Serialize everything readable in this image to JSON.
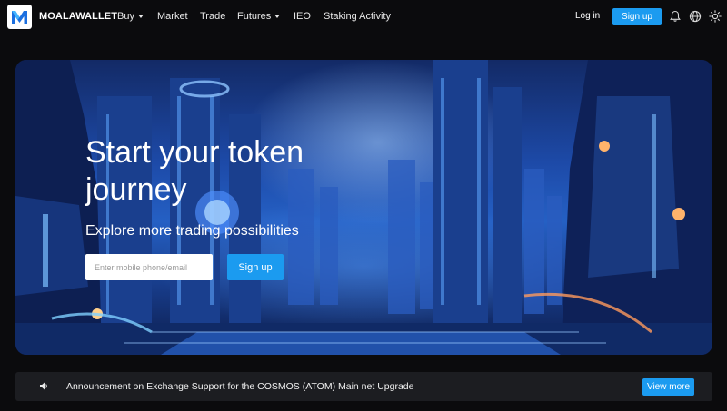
{
  "brand": {
    "logo_letter": "M",
    "name": "MOALAWALLET"
  },
  "nav": {
    "items": [
      {
        "label": "Buy",
        "has_dropdown": true
      },
      {
        "label": "Market",
        "has_dropdown": false
      },
      {
        "label": "Trade",
        "has_dropdown": false
      },
      {
        "label": "Futures",
        "has_dropdown": true
      },
      {
        "label": "IEO",
        "has_dropdown": false
      },
      {
        "label": "Staking Activity",
        "has_dropdown": false
      }
    ],
    "login_label": "Log in",
    "signup_label": "Sign up",
    "icons": [
      "bell-icon",
      "globe-icon",
      "sun-icon"
    ]
  },
  "hero": {
    "title": "Start your token journey",
    "subtitle": "Explore more trading possibilities",
    "input_placeholder": "Enter mobile phone/email",
    "signup_label": "Sign up"
  },
  "announcement": {
    "icon": "speaker-icon",
    "text": "Announcement on Exchange Support for the COSMOS (ATOM) Main net Upgrade",
    "button_label": "View more"
  },
  "colors": {
    "accent": "#1b9bf0",
    "background": "#0b0b0d",
    "announcement_bg": "#1c1d21"
  }
}
